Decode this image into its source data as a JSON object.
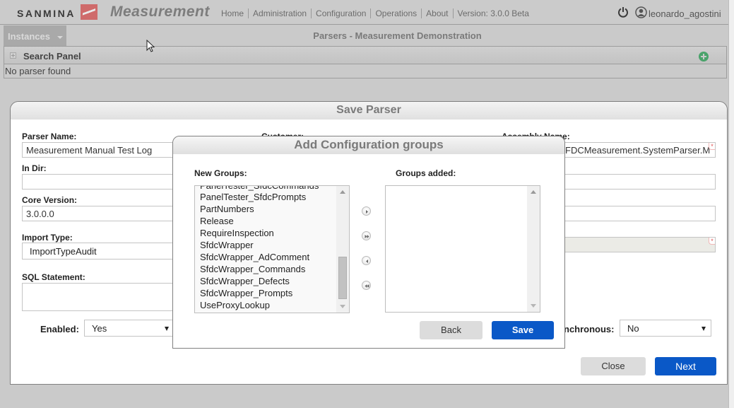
{
  "header": {
    "brand": "SANMINA",
    "app_title": "Measurement",
    "nav": [
      "Home",
      "Administration",
      "Configuration",
      "Operations",
      "About",
      "Version: 3.0.0 Beta"
    ],
    "username": "leonardo_agostini",
    "icons": {
      "power": "power-icon",
      "user": "user-icon"
    }
  },
  "titlebar": {
    "instances_label": "Instances",
    "page_title": "Parsers - Measurement Demonstration"
  },
  "search_panel": {
    "title": "Search Panel",
    "empty_message": "No parser found"
  },
  "save_parser": {
    "title": "Save Parser",
    "fields": {
      "parser_name": {
        "label": "Parser Name:",
        "value": "Measurement Manual Test Log"
      },
      "customer": {
        "label": "Customer:"
      },
      "assembly_name": {
        "label": "Assembly Name:",
        "value": "FDCMeasurement.SystemParser.M"
      },
      "in_dir": {
        "label": "In Dir:",
        "value": ""
      },
      "core_version": {
        "label": "Core Version:",
        "value": "3.0.0.0"
      },
      "import_type": {
        "label": "Import Type:",
        "value": "ImportTypeAudit"
      },
      "sql_statement": {
        "label": "SQL Statement:",
        "value": ""
      },
      "enabled": {
        "label": "Enabled:",
        "value": "Yes"
      },
      "synchronous": {
        "label": "nchronous:",
        "value": "No"
      }
    },
    "required_marker": "*",
    "buttons": {
      "close": "Close",
      "next": "Next"
    }
  },
  "modal": {
    "title": "Add Configuration groups",
    "new_groups_label": "New Groups:",
    "groups_added_label": "Groups added:",
    "new_groups": [
      "PanelTester_SfdcCommands",
      "PanelTester_SfdcPrompts",
      "PartNumbers",
      "Release",
      "RequireInspection",
      "SfdcWrapper",
      "SfdcWrapper_AdComment",
      "SfdcWrapper_Commands",
      "SfdcWrapper_Defects",
      "SfdcWrapper_Prompts",
      "UseProxyLookup"
    ],
    "groups_added": [],
    "buttons": {
      "back": "Back",
      "save": "Save"
    }
  },
  "colors": {
    "primary_button": "#0a58c7",
    "secondary_button": "#dcdcdc",
    "add_icon": "#4aa36b",
    "required": "#e05555"
  }
}
